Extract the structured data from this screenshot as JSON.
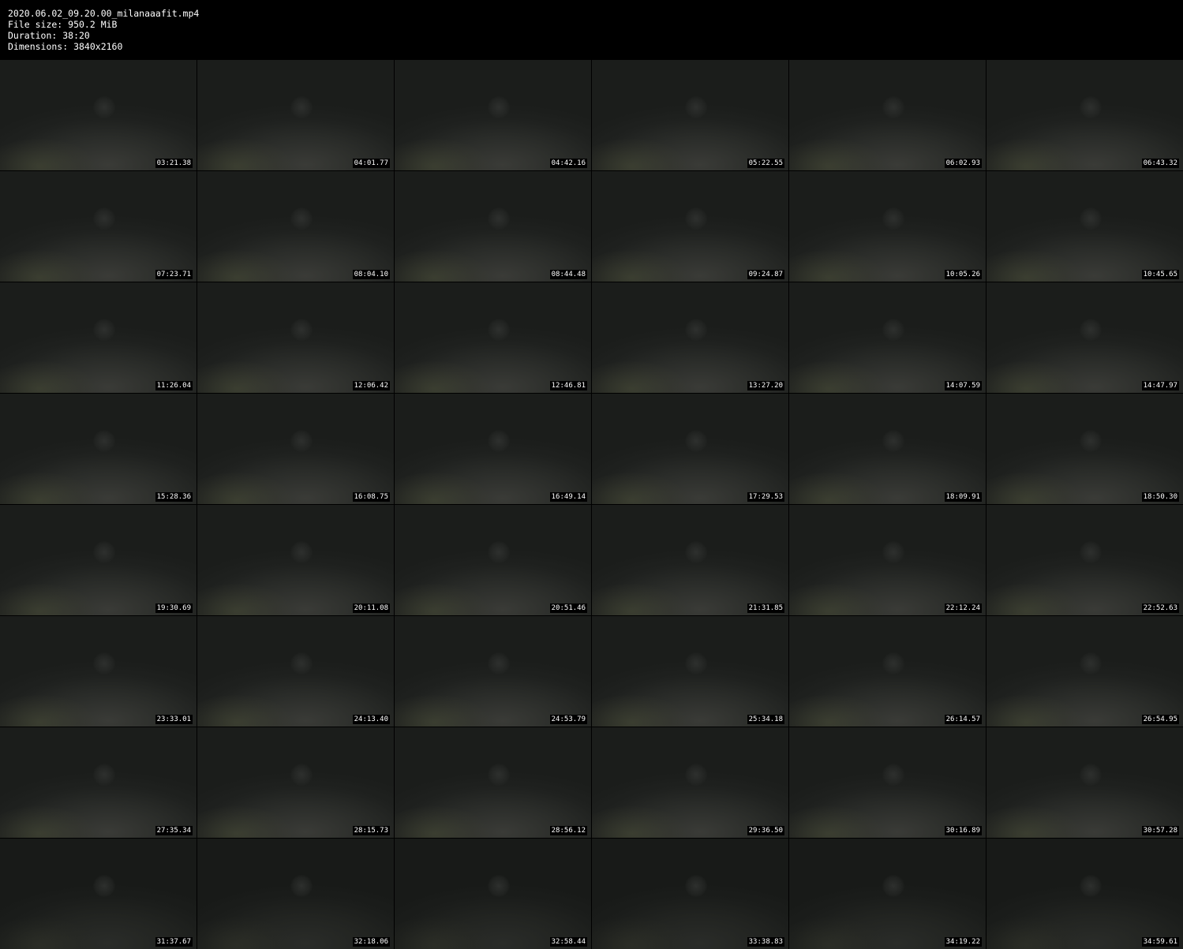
{
  "info": {
    "filename": "2020.06.02_09.20.00_milanaaafit.mp4",
    "file_size": "File size: 950.2 MiB",
    "duration": "Duration: 38:20",
    "dimensions": "Dimensions: 3840x2160"
  },
  "thumbnails": [
    "03:21.38",
    "04:01.77",
    "04:42.16",
    "05:22.55",
    "06:02.93",
    "06:43.32",
    "07:23.71",
    "08:04.10",
    "08:44.48",
    "09:24.87",
    "10:05.26",
    "10:45.65",
    "11:26.04",
    "12:06.42",
    "12:46.81",
    "13:27.20",
    "14:07.59",
    "14:47.97",
    "15:28.36",
    "16:08.75",
    "16:49.14",
    "17:29.53",
    "18:09.91",
    "18:50.30",
    "19:30.69",
    "20:11.08",
    "20:51.46",
    "21:31.85",
    "22:12.24",
    "22:52.63",
    "23:33.01",
    "24:13.40",
    "24:53.79",
    "25:34.18",
    "26:14.57",
    "26:54.95",
    "27:35.34",
    "28:15.73",
    "28:56.12",
    "29:36.50",
    "30:16.89",
    "30:57.28",
    "31:37.67",
    "32:18.06",
    "32:58.44",
    "33:38.83",
    "34:19.22",
    "34:59.61"
  ]
}
